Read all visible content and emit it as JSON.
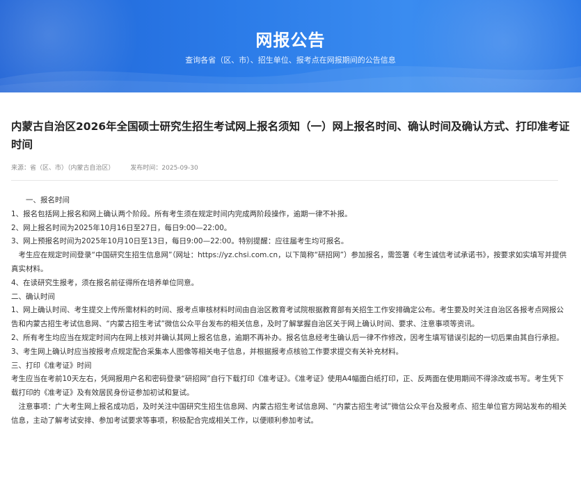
{
  "banner": {
    "title": "网报公告",
    "subtitle": "查询各省（区、市）、招生单位、报考点在网报期间的公告信息"
  },
  "article": {
    "title": "内蒙古自治区2026年全国硕士研究生招生考试网上报名须知（一）网上报名时间、确认时间及确认方式、打印准考证时间",
    "source": "来源：省（区、市）（内蒙古自治区）",
    "publish_time": "发布时间：2025-09-30",
    "paragraphs": [
      "一、报名时间",
      "1、报名包括网上报名和网上确认两个阶段。所有考生须在规定时间内完成两阶段操作，逾期一律不补报。",
      "2、网上报名时间为2025年10月16日至27日，每日9:00—22:00。",
      "3、网上预报名时间为2025年10月10日至13日，每日9:00—22:00。特别提醒：应往届考生均可报名。",
      "考生应在规定时间登录“中国研究生招生信息网”（网址：https://yz.chsi.com.cn，以下简称“研招网”）参加报名，需签署《考生诚信考试承诺书》，按要求如实填写并提供真实材料。",
      "4、在读研究生报考，须在报名前征得所在培养单位同意。",
      "二、确认时间",
      "1、网上确认时间、考生提交上传所需材料的时间、报考点审核材料时间由自治区教育考试院根据教育部有关招生工作安排确定公布。考生要及时关注自治区各报考点网报公告和内蒙古招生考试信息网、“内蒙古招生考试”微信公众平台发布的相关信息，及时了解掌握自治区关于网上确认时间、要求、注意事项等资讯。",
      "2、所有考生均应当在规定时间内在网上核对并确认其网上报名信息，逾期不再补办。报名信息经考生确认后一律不作修改，因考生填写错误引起的一切后果由其自行承担。",
      "3、考生网上确认时应当按报考点规定配合采集本人图像等相关电子信息，并根据报考点核验工作要求提交有关补充材料。",
      "三、打印《准考证》时间",
      "考生应当在考前10天左右，凭网报用户名和密码登录“研招网”自行下载打印《准考证》。《准考证》使用A4幅面白纸打印，正、反两面在使用期间不得涂改或书写。考生凭下载打印的《准考证》及有效居民身份证参加初试和复试。",
      "注意事项：广大考生网上报名成功后，及时关注中国研究生招生信息网、内蒙古招生考试信息网、“内蒙古招生考试”微信公众平台及报考点、招生单位官方网站发布的相关信息，主动了解考试安排、参加考试要求等事项，积极配合完成相关工作，以便顺利参加考试。"
    ]
  },
  "colors": {
    "banner_start": "#1f63d6",
    "banner_end": "#3a8cf0",
    "text": "#333333",
    "meta": "#8a8a8a"
  }
}
